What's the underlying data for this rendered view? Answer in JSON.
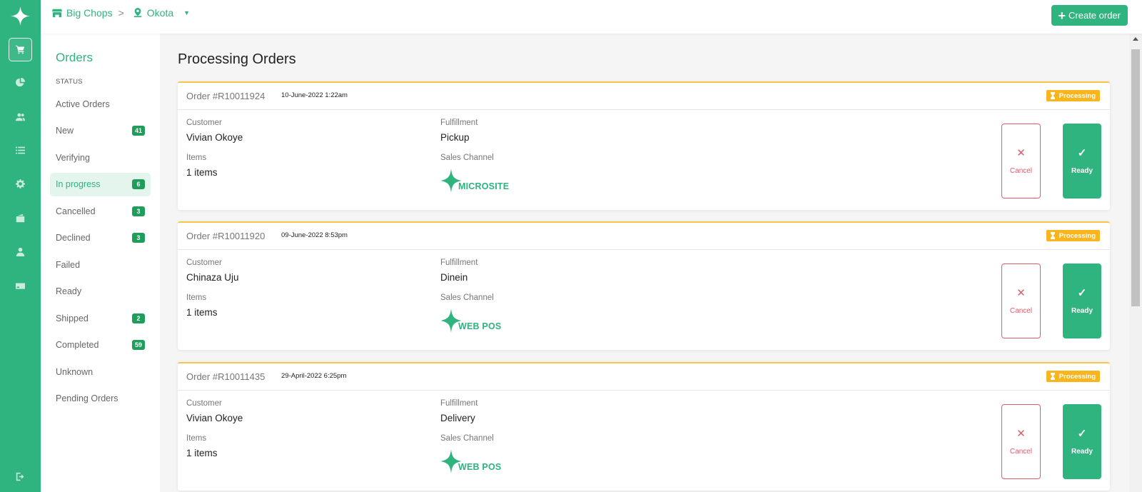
{
  "app": {
    "name": "Orders dashboard",
    "brand_color": "#2fb37f"
  },
  "rail": {
    "items": [
      {
        "icon": "cart-icon",
        "active": true
      },
      {
        "icon": "pie-chart-icon",
        "active": false
      },
      {
        "icon": "users-icon",
        "active": false
      },
      {
        "icon": "list-icon",
        "active": false
      },
      {
        "icon": "gear-icon",
        "active": false
      },
      {
        "icon": "wallet-icon",
        "active": false
      },
      {
        "icon": "user-icon",
        "active": false
      },
      {
        "icon": "card-icon",
        "active": false
      }
    ],
    "logout_icon": "logout-icon"
  },
  "topbar": {
    "store": "Big Chops",
    "location": "Okota",
    "create_label": "Create order"
  },
  "sidebar": {
    "title": "Orders",
    "section": "STATUS",
    "items": [
      {
        "label": "Active Orders",
        "count": ""
      },
      {
        "label": "New",
        "count": "41"
      },
      {
        "label": "Verifying",
        "count": ""
      },
      {
        "label": "In progress",
        "count": "6"
      },
      {
        "label": "Cancelled",
        "count": "3"
      },
      {
        "label": "Declined",
        "count": "3"
      },
      {
        "label": "Failed",
        "count": ""
      },
      {
        "label": "Ready",
        "count": ""
      },
      {
        "label": "Shipped",
        "count": "2"
      },
      {
        "label": "Completed",
        "count": "59"
      },
      {
        "label": "Unknown",
        "count": ""
      },
      {
        "label": "Pending Orders",
        "count": ""
      }
    ]
  },
  "main": {
    "title": "Processing Orders",
    "labels": {
      "customer": "Customer",
      "items": "Items",
      "fulfillment": "Fulfillment",
      "channel": "Sales Channel",
      "cancel": "Cancel",
      "ready": "Ready"
    },
    "orders": [
      {
        "number": "Order #R10011924",
        "date": "10-June-2022 1:22am",
        "status": "Processing",
        "customer": "Vivian Okoye",
        "items": "1 items",
        "fulfillment": "Pickup",
        "channel": "MICROSITE"
      },
      {
        "number": "Order #R10011920",
        "date": "09-June-2022 8:53pm",
        "status": "Processing",
        "customer": "Chinaza Uju",
        "items": "1 items",
        "fulfillment": "Dinein",
        "channel": "WEB POS"
      },
      {
        "number": "Order #R10011435",
        "date": "29-April-2022 6:25pm",
        "status": "Processing",
        "customer": "Vivian Okoye",
        "items": "1 items",
        "fulfillment": "Delivery",
        "channel": "WEB POS"
      }
    ]
  }
}
